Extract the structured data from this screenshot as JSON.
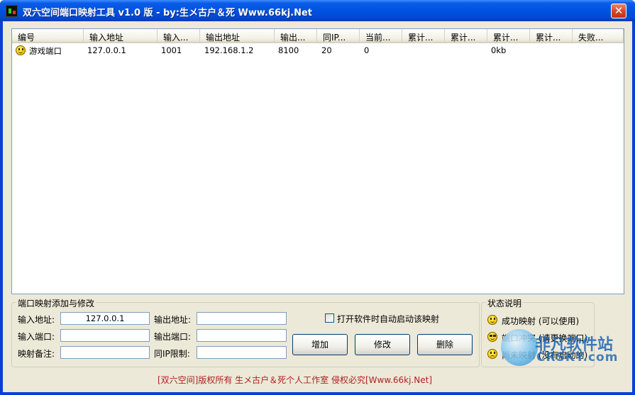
{
  "window": {
    "title": "双六空间端口映射工具 v1.0 版 - by:生メ古户＆死 Www.66kj.Net",
    "close_glyph": "✕"
  },
  "list": {
    "columns": [
      "编号",
      "输入地址",
      "输入...",
      "输出地址",
      "输出...",
      "同IP...",
      "当前...",
      "累计...",
      "累计...",
      "累计...",
      "累计...",
      "失败..."
    ],
    "rows": [
      {
        "status": "success",
        "cells": [
          "游戏端口",
          "127.0.0.1",
          "1001",
          "192.168.1.2",
          "8100",
          "20",
          "0",
          "",
          "",
          "0kb",
          "",
          ""
        ]
      }
    ]
  },
  "form": {
    "legend": "端口映射添加与修改",
    "input_address_label": "输入地址:",
    "input_address_value": "127.0.0.1",
    "input_port_label": "输入端口:",
    "input_port_value": "",
    "remark_label": "映射备注:",
    "remark_value": "",
    "output_address_label": "输出地址:",
    "output_address_value": "",
    "output_port_label": "输出端口:",
    "output_port_value": "",
    "same_ip_limit_label": "同IP限制:",
    "same_ip_limit_value": "",
    "autostart_label": "打开软件时自动启动该映射",
    "autostart_checked": false,
    "add_label": "增加",
    "modify_label": "修改",
    "delete_label": "删除"
  },
  "legend_panel": {
    "title": "状态说明",
    "items": [
      {
        "icon": "smile-icon",
        "label": "成功映射 (可以使用)"
      },
      {
        "icon": "glasses-face-icon",
        "label": "端口冲突 (请更换端口)"
      },
      {
        "icon": "frown-icon",
        "label": "尚未映射 (没有启动的)"
      }
    ]
  },
  "footer": "[双六空间]版权所有 生メ古户＆死个人工作室 侵权必究[Www.66kj.Net]",
  "watermark": {
    "cn": "非凡软件站",
    "en": "CRSKY.com"
  }
}
